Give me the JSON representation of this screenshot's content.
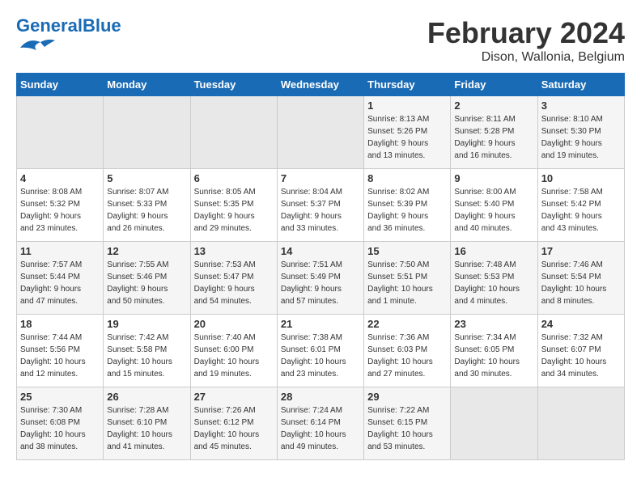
{
  "header": {
    "logo_text_general": "General",
    "logo_text_blue": "Blue",
    "month_year": "February 2024",
    "location": "Dison, Wallonia, Belgium"
  },
  "calendar": {
    "days_of_week": [
      "Sunday",
      "Monday",
      "Tuesday",
      "Wednesday",
      "Thursday",
      "Friday",
      "Saturday"
    ],
    "weeks": [
      [
        {
          "day": "",
          "info": ""
        },
        {
          "day": "",
          "info": ""
        },
        {
          "day": "",
          "info": ""
        },
        {
          "day": "",
          "info": ""
        },
        {
          "day": "1",
          "info": "Sunrise: 8:13 AM\nSunset: 5:26 PM\nDaylight: 9 hours\nand 13 minutes."
        },
        {
          "day": "2",
          "info": "Sunrise: 8:11 AM\nSunset: 5:28 PM\nDaylight: 9 hours\nand 16 minutes."
        },
        {
          "day": "3",
          "info": "Sunrise: 8:10 AM\nSunset: 5:30 PM\nDaylight: 9 hours\nand 19 minutes."
        }
      ],
      [
        {
          "day": "4",
          "info": "Sunrise: 8:08 AM\nSunset: 5:32 PM\nDaylight: 9 hours\nand 23 minutes."
        },
        {
          "day": "5",
          "info": "Sunrise: 8:07 AM\nSunset: 5:33 PM\nDaylight: 9 hours\nand 26 minutes."
        },
        {
          "day": "6",
          "info": "Sunrise: 8:05 AM\nSunset: 5:35 PM\nDaylight: 9 hours\nand 29 minutes."
        },
        {
          "day": "7",
          "info": "Sunrise: 8:04 AM\nSunset: 5:37 PM\nDaylight: 9 hours\nand 33 minutes."
        },
        {
          "day": "8",
          "info": "Sunrise: 8:02 AM\nSunset: 5:39 PM\nDaylight: 9 hours\nand 36 minutes."
        },
        {
          "day": "9",
          "info": "Sunrise: 8:00 AM\nSunset: 5:40 PM\nDaylight: 9 hours\nand 40 minutes."
        },
        {
          "day": "10",
          "info": "Sunrise: 7:58 AM\nSunset: 5:42 PM\nDaylight: 9 hours\nand 43 minutes."
        }
      ],
      [
        {
          "day": "11",
          "info": "Sunrise: 7:57 AM\nSunset: 5:44 PM\nDaylight: 9 hours\nand 47 minutes."
        },
        {
          "day": "12",
          "info": "Sunrise: 7:55 AM\nSunset: 5:46 PM\nDaylight: 9 hours\nand 50 minutes."
        },
        {
          "day": "13",
          "info": "Sunrise: 7:53 AM\nSunset: 5:47 PM\nDaylight: 9 hours\nand 54 minutes."
        },
        {
          "day": "14",
          "info": "Sunrise: 7:51 AM\nSunset: 5:49 PM\nDaylight: 9 hours\nand 57 minutes."
        },
        {
          "day": "15",
          "info": "Sunrise: 7:50 AM\nSunset: 5:51 PM\nDaylight: 10 hours\nand 1 minute."
        },
        {
          "day": "16",
          "info": "Sunrise: 7:48 AM\nSunset: 5:53 PM\nDaylight: 10 hours\nand 4 minutes."
        },
        {
          "day": "17",
          "info": "Sunrise: 7:46 AM\nSunset: 5:54 PM\nDaylight: 10 hours\nand 8 minutes."
        }
      ],
      [
        {
          "day": "18",
          "info": "Sunrise: 7:44 AM\nSunset: 5:56 PM\nDaylight: 10 hours\nand 12 minutes."
        },
        {
          "day": "19",
          "info": "Sunrise: 7:42 AM\nSunset: 5:58 PM\nDaylight: 10 hours\nand 15 minutes."
        },
        {
          "day": "20",
          "info": "Sunrise: 7:40 AM\nSunset: 6:00 PM\nDaylight: 10 hours\nand 19 minutes."
        },
        {
          "day": "21",
          "info": "Sunrise: 7:38 AM\nSunset: 6:01 PM\nDaylight: 10 hours\nand 23 minutes."
        },
        {
          "day": "22",
          "info": "Sunrise: 7:36 AM\nSunset: 6:03 PM\nDaylight: 10 hours\nand 27 minutes."
        },
        {
          "day": "23",
          "info": "Sunrise: 7:34 AM\nSunset: 6:05 PM\nDaylight: 10 hours\nand 30 minutes."
        },
        {
          "day": "24",
          "info": "Sunrise: 7:32 AM\nSunset: 6:07 PM\nDaylight: 10 hours\nand 34 minutes."
        }
      ],
      [
        {
          "day": "25",
          "info": "Sunrise: 7:30 AM\nSunset: 6:08 PM\nDaylight: 10 hours\nand 38 minutes."
        },
        {
          "day": "26",
          "info": "Sunrise: 7:28 AM\nSunset: 6:10 PM\nDaylight: 10 hours\nand 41 minutes."
        },
        {
          "day": "27",
          "info": "Sunrise: 7:26 AM\nSunset: 6:12 PM\nDaylight: 10 hours\nand 45 minutes."
        },
        {
          "day": "28",
          "info": "Sunrise: 7:24 AM\nSunset: 6:14 PM\nDaylight: 10 hours\nand 49 minutes."
        },
        {
          "day": "29",
          "info": "Sunrise: 7:22 AM\nSunset: 6:15 PM\nDaylight: 10 hours\nand 53 minutes."
        },
        {
          "day": "",
          "info": ""
        },
        {
          "day": "",
          "info": ""
        }
      ]
    ]
  }
}
